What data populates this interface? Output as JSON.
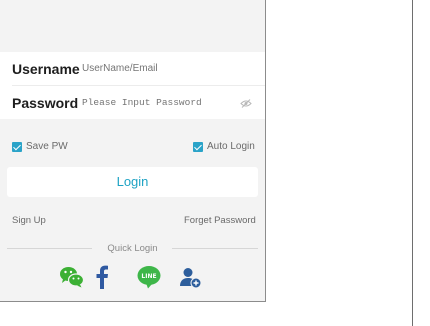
{
  "form": {
    "username_label": "Username",
    "username_placeholder": "UserName/Email",
    "password_label": "Password",
    "password_placeholder": "Please Input Password"
  },
  "options": {
    "save_pw": "Save PW",
    "auto_login": "Auto Login"
  },
  "login_button": "Login",
  "links": {
    "sign_up": "Sign Up",
    "forget_password": "Forget Password"
  },
  "quick_login": {
    "label": "Quick Login",
    "icons": [
      "wechat-icon",
      "facebook-icon",
      "line-icon",
      "add-user-icon"
    ]
  },
  "colors": {
    "accent": "#1ea3c4",
    "wechat": "#3cb034",
    "facebook": "#2f59a1",
    "line": "#3eb649",
    "user": "#2d5e9c"
  }
}
